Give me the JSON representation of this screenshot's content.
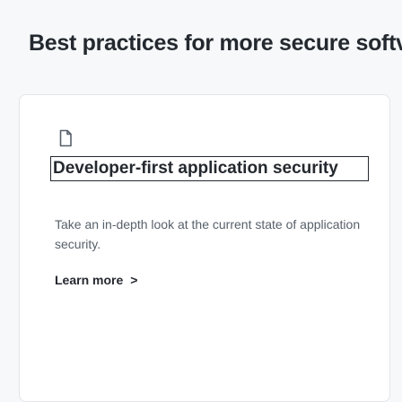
{
  "page": {
    "heading": "Best practices for more secure softv"
  },
  "card": {
    "icon": "document-icon",
    "title": "Developer-first application security",
    "description": "Take an in-depth look at the current state of application security.",
    "link": {
      "label": "Learn more",
      "chevron": ">"
    }
  }
}
